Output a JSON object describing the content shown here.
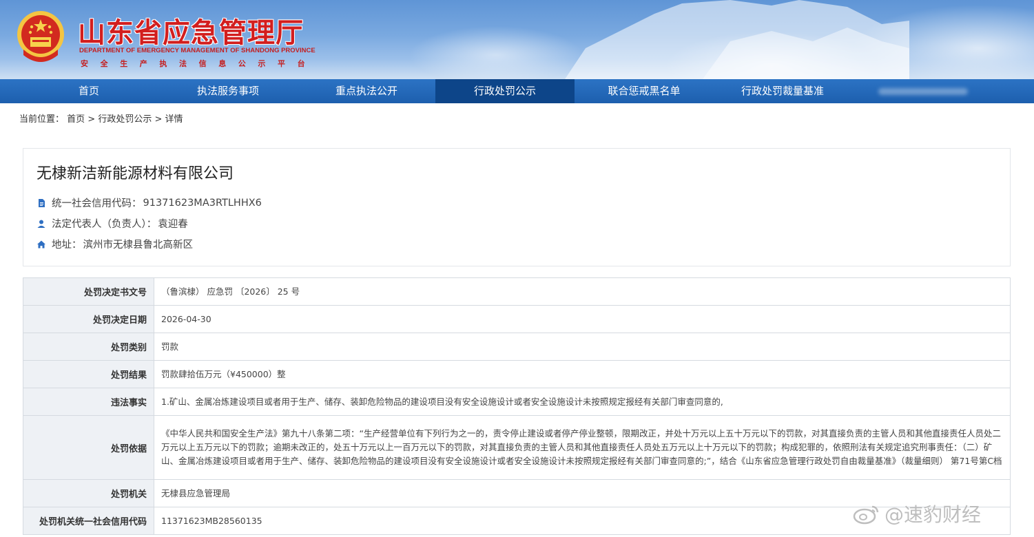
{
  "header": {
    "title": "山东省应急管理厅",
    "title_en": "DEPARTMENT OF EMERGENCY MANAGEMENT OF SHANDONG PROVINCE",
    "subtitle": "安全生产执法信息公示平台",
    "emblem_icon": "national-emblem"
  },
  "nav": {
    "items": [
      {
        "label": "首页"
      },
      {
        "label": "执法服务事项"
      },
      {
        "label": "重点执法公开"
      },
      {
        "label": "行政处罚公示"
      },
      {
        "label": "联合惩戒黑名单"
      },
      {
        "label": "行政处罚裁量基准"
      }
    ],
    "active_index": 3
  },
  "breadcrumb": {
    "prefix": "当前位置：",
    "path": "首页 > 行政处罚公示 > 详情"
  },
  "company": {
    "name": "无棣新洁新能源材料有限公司",
    "credit_label": "统一社会信用代码：",
    "credit_code": "91371623MA3RTLHHX6",
    "legal_label": "法定代表人（负责人）：",
    "legal_rep": "袁迎春",
    "address_label": "地址：",
    "address": "滨州市无棣县鲁北高新区"
  },
  "details": [
    {
      "label": "处罚决定书文号",
      "value": "（鲁滨棣） 应急罚 〔2026〕 25 号"
    },
    {
      "label": "处罚决定日期",
      "value": "2026-04-30"
    },
    {
      "label": "处罚类别",
      "value": "罚款"
    },
    {
      "label": "处罚结果",
      "value": "罚款肆拾伍万元（¥450000）整"
    },
    {
      "label": "违法事实",
      "value": "1.矿山、金属冶炼建设项目或者用于生产、储存、装卸危险物品的建设项目没有安全设施设计或者安全设施设计未按照规定报经有关部门审查同意的,"
    },
    {
      "label": "处罚依据",
      "value": "《中华人民共和国安全生产法》第九十八条第二项：“生产经营单位有下列行为之一的，责令停止建设或者停产停业整顿，限期改正，并处十万元以上五十万元以下的罚款，对其直接负责的主管人员和其他直接责任人员处二万元以上五万元以下的罚款；逾期未改正的，处五十万元以上一百万元以下的罚款，对其直接负责的主管人员和其他直接责任人员处五万元以上十万元以下的罚款；构成犯罪的，依照刑法有关规定追究刑事责任：（二）矿山、金属冶炼建设项目或者用于生产、储存、装卸危险物品的建设项目没有安全设施设计或者安全设施设计未按照规定报经有关部门审查同意的;”，结合《山东省应急管理行政处罚自由裁量基准》（裁量细则） 第71号第C档"
    },
    {
      "label": "处罚机关",
      "value": "无棣县应急管理局"
    },
    {
      "label": "处罚机关统一社会信用代码",
      "value": "11371623MB28560135"
    }
  ],
  "watermark": {
    "text": "@速豹财经"
  }
}
